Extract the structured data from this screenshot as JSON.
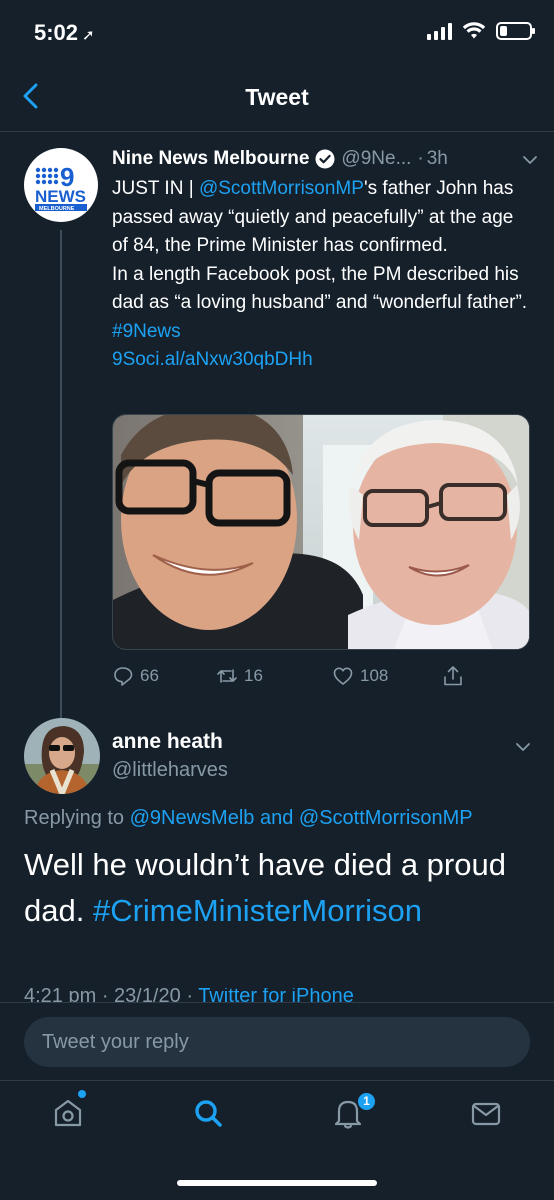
{
  "status_bar": {
    "time": "5:02",
    "location_glyph": "➚",
    "battery_level": 0.25
  },
  "header": {
    "title": "Tweet",
    "back_icon": "chevron-left-icon"
  },
  "tweet": {
    "author_name": "Nine News Melbourne",
    "handle": "@9Ne...",
    "separator": "·",
    "time": "3h",
    "avatar_text_top": "9",
    "avatar_text_news": "NEWS",
    "avatar_text_city": "MELBOURNE",
    "text_prefix": "JUST IN | ",
    "mention": "@ScottMorrisonMP",
    "text_after_mention": "'s father John has passed away “quietly and peacefully” at the age of 84, the Prime Minister has confirmed.",
    "text_para2": "In a length Facebook post, the PM described his dad as “a loving husband” and “wonderful father”. ",
    "hashtag": "#9News",
    "url": "9Soci.al/aNxw30qbDHh",
    "reply_count": "66",
    "retweet_count": "16",
    "like_count": "108"
  },
  "reply": {
    "author_name": "anne heath",
    "handle": "@littleharves",
    "replying_label": "Replying to ",
    "replying_to_1": "@9NewsMelb",
    "replying_and": " and ",
    "replying_to_2": "@ScottMorrisonMP",
    "text": "Well he wouldn’t have died a proud dad. ",
    "hashtag": "#CrimeMinisterMorrison",
    "meta_time": "4:21 pm · 23/1/20 · ",
    "meta_source": "Twitter for iPhone"
  },
  "composer": {
    "placeholder": "Tweet your reply"
  },
  "tabbar": {
    "notification_badge": "1",
    "tabs": [
      "home-icon",
      "search-icon",
      "notifications-icon",
      "messages-icon"
    ]
  },
  "colors": {
    "background": "#15202b",
    "accent": "#1da1f2",
    "secondary_text": "#8899a6"
  }
}
